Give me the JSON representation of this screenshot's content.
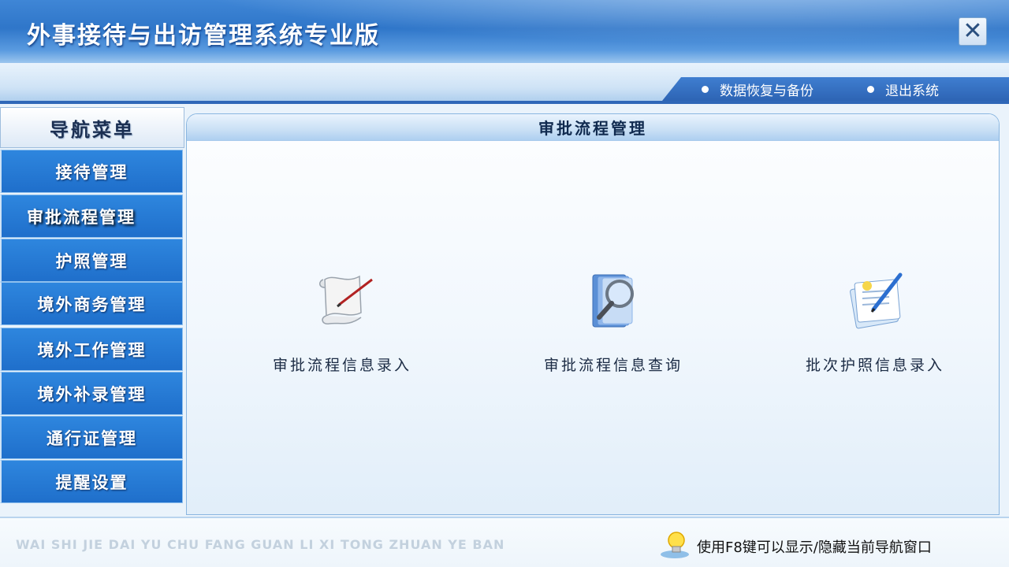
{
  "window": {
    "title": "外事接待与出访管理系统专业版",
    "close_symbol": "✕"
  },
  "toolbar": {
    "restore_backup": "数据恢复与备份",
    "exit": "退出系统"
  },
  "sidebar": {
    "header": "导航菜单",
    "items": [
      {
        "label": "接待管理"
      },
      {
        "label": "审批流程管理"
      },
      {
        "label": "护照管理"
      },
      {
        "label": "境外商务管理"
      },
      {
        "label": "境外工作管理"
      },
      {
        "label": "境外补录管理"
      },
      {
        "label": "通行证管理"
      },
      {
        "label": "提醒设置"
      }
    ],
    "active_index": 1
  },
  "panel": {
    "title": "审批流程管理",
    "tiles": [
      {
        "label": "审批流程信息录入",
        "icon": "scroll-pen-icon"
      },
      {
        "label": "审批流程信息查询",
        "icon": "magnifier-book-icon"
      },
      {
        "label": "批次护照信息录入",
        "icon": "notepad-pen-icon"
      }
    ]
  },
  "footer": {
    "pinyin": "WAI SHI JIE DAI YU CHU FANG GUAN LI XI TONG ZHUAN YE BAN",
    "hint": "使用F8键可以显示/隐藏当前导航窗口"
  },
  "colors": {
    "nav_blue": "#1f6fcb",
    "title_blue": "#2f76c9"
  }
}
